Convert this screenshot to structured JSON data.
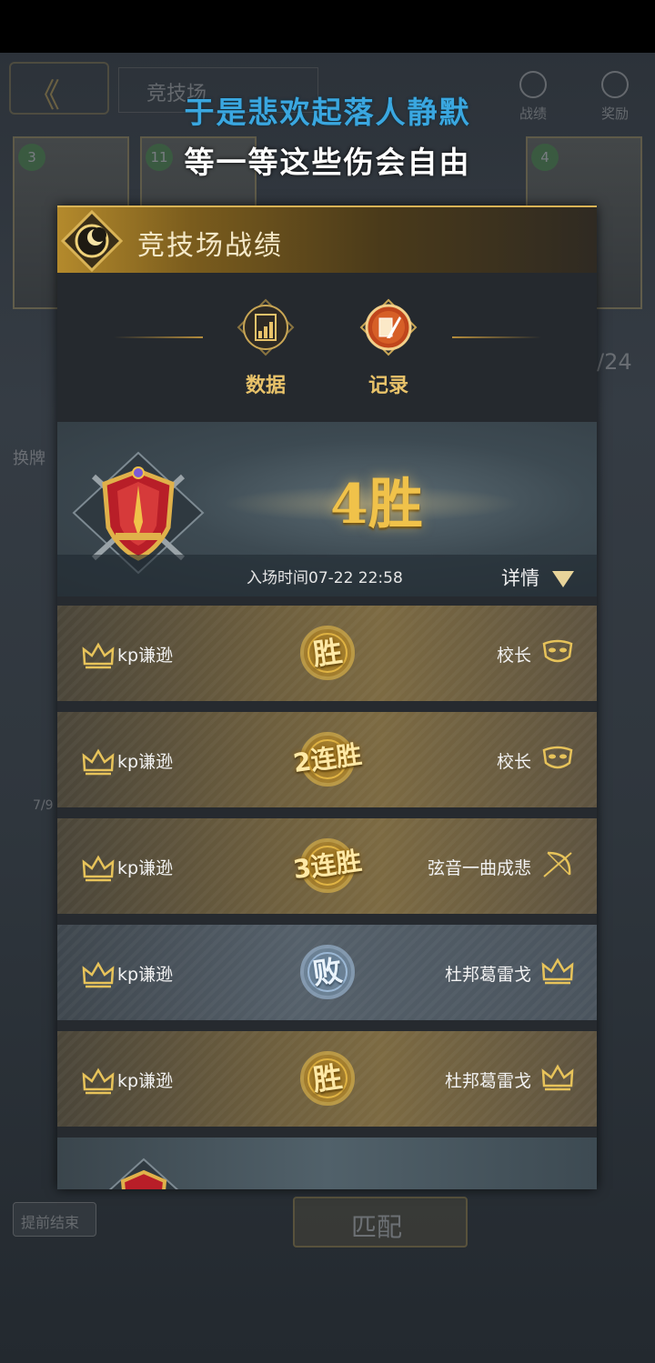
{
  "lyrics": {
    "line1": "于是悲欢起落人静默",
    "line2": "等一等这些伤会自由"
  },
  "background": {
    "tab_title": "竞技场",
    "top_icons": [
      {
        "label": "战绩",
        "icon": "record-icon"
      },
      {
        "label": "奖励",
        "icon": "reward-icon"
      }
    ],
    "card_levels": [
      "3",
      "11",
      "4"
    ],
    "side_texts": [
      "换牌",
      "/24",
      "7/9"
    ],
    "end_button": "提前结束",
    "match_button": "匹配"
  },
  "panel": {
    "title": "竞技场战绩",
    "tabs": [
      {
        "label": "数据",
        "icon": "chart-icon",
        "active": false
      },
      {
        "label": "记录",
        "icon": "quill-icon",
        "active": true
      }
    ],
    "summary": {
      "wins": "4胜",
      "entry_time": "入场时间07-22 22:58",
      "detail_label": "详情"
    },
    "records": [
      {
        "player": "kp谦逊",
        "result": "胜",
        "type": "win",
        "opponent": "校长",
        "opponent_icon": "mask-icon"
      },
      {
        "player": "kp谦逊",
        "result": "2连胜",
        "type": "win",
        "opponent": "校长",
        "opponent_icon": "mask-icon"
      },
      {
        "player": "kp谦逊",
        "result": "3连胜",
        "type": "win",
        "opponent": "弦音一曲成悲",
        "opponent_icon": "bow-icon"
      },
      {
        "player": "kp谦逊",
        "result": "败",
        "type": "lose",
        "opponent": "杜邦葛雷戈",
        "opponent_icon": "crown-icon"
      },
      {
        "player": "kp谦逊",
        "result": "胜",
        "type": "win",
        "opponent": "杜邦葛雷戈",
        "opponent_icon": "crown-icon"
      }
    ]
  },
  "colors": {
    "gold": "#f0c24a",
    "lyric_blue": "#3aa7e0",
    "lose_blue": "#a9c7e6"
  }
}
